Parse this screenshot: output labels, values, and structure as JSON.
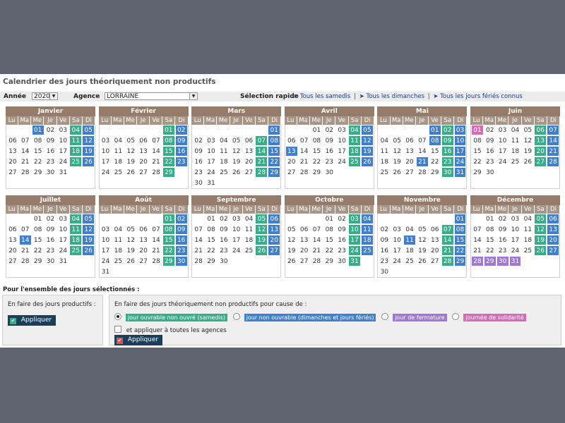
{
  "title": "Calendrier des jours théoriquement non productifs",
  "toolbar": {
    "year_label": "Année",
    "year_value": "2020",
    "agency_label": "Agence",
    "agency_value": "LORRAINE",
    "quick_label": "Sélection rapide",
    "quick_links": [
      "Tous les samedis",
      "Tous les dimanches",
      "Tous les jours fériés connus"
    ],
    "arrow_glyph": "➤",
    "separator": "|",
    "dropdown_glyph": "▼"
  },
  "day_headers": [
    "Lu",
    "Ma",
    "Me",
    "Je",
    "Ve",
    "Sa",
    "Di"
  ],
  "colors": {
    "saturday": "#36ae8a",
    "sunday": "#3f7fce",
    "holiday": "#3f7fce",
    "solidarity": "#d86bb8",
    "closure": "#9f77d6",
    "month_header": "#957b6a"
  },
  "months": [
    {
      "name": "Janvier",
      "offset": 2,
      "days": 31,
      "holidays": [
        1
      ],
      "solidarity": [],
      "closure": []
    },
    {
      "name": "Février",
      "offset": 5,
      "days": 29,
      "holidays": [],
      "solidarity": [],
      "closure": []
    },
    {
      "name": "Mars",
      "offset": 6,
      "days": 31,
      "holidays": [],
      "solidarity": [],
      "closure": []
    },
    {
      "name": "Avril",
      "offset": 2,
      "days": 30,
      "holidays": [
        13
      ],
      "solidarity": [],
      "closure": []
    },
    {
      "name": "Mai",
      "offset": 4,
      "days": 31,
      "holidays": [
        1,
        8,
        21
      ],
      "solidarity": [],
      "closure": []
    },
    {
      "name": "Juin",
      "offset": 0,
      "days": 30,
      "holidays": [],
      "solidarity": [
        1
      ],
      "closure": []
    },
    {
      "name": "Juillet",
      "offset": 2,
      "days": 31,
      "holidays": [
        14
      ],
      "solidarity": [],
      "closure": []
    },
    {
      "name": "Août",
      "offset": 5,
      "days": 31,
      "holidays": [],
      "solidarity": [],
      "closure": []
    },
    {
      "name": "Septembre",
      "offset": 1,
      "days": 30,
      "holidays": [],
      "solidarity": [],
      "closure": []
    },
    {
      "name": "Octobre",
      "offset": 3,
      "days": 31,
      "holidays": [],
      "solidarity": [],
      "closure": []
    },
    {
      "name": "Novembre",
      "offset": 6,
      "days": 30,
      "holidays": [
        11
      ],
      "solidarity": [],
      "closure": []
    },
    {
      "name": "Décembre",
      "offset": 1,
      "days": 31,
      "holidays": [],
      "solidarity": [],
      "closure": [
        28,
        29,
        30,
        31
      ]
    }
  ],
  "bottom": {
    "section_label": "Pour l'ensemble des jours sélectionnés :",
    "left_text": "En faire des jours productifs :",
    "right_text": "En faire des jours théoriquement non productifs pour cause de :",
    "apply_label": "Appliquer",
    "check_glyph": "✔",
    "options": [
      {
        "label": "jour ouvrable non ouvré (samedis)",
        "color": "#36ae8a",
        "selected": true
      },
      {
        "label": "jour non ouvrable (dimanches et jours fériés)",
        "color": "#3f7fce",
        "selected": false
      },
      {
        "label": "jour de fermeture",
        "color": "#9f77d6",
        "selected": false
      },
      {
        "label": "journée de solidarité",
        "color": "#d86bb8",
        "selected": false
      }
    ],
    "all_agencies_label": "et appliquer à toutes les agences"
  }
}
